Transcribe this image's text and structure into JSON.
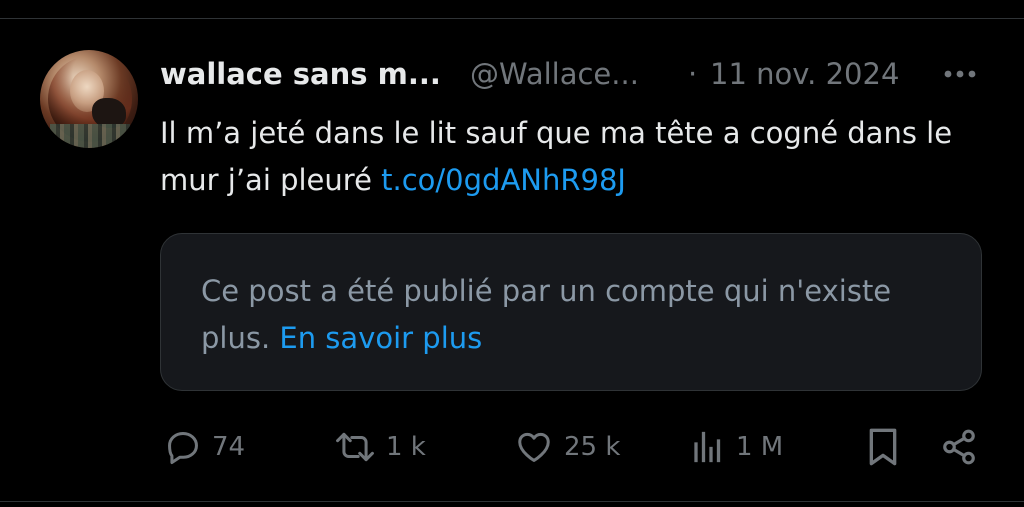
{
  "post": {
    "author": {
      "display_name": "wallace sans m...",
      "handle": "@Wallace...",
      "avatar_icon": "avatar-photo"
    },
    "separator": "·",
    "date": "11 nov. 2024",
    "more_icon": "more-horizontal-icon",
    "text": "Il m’a jeté dans le lit sauf que ma tête a cogné dans le mur j’ai pleuré ",
    "link": "t.co/0gdANhR98J"
  },
  "notice": {
    "text": "Ce post a été publié par un compte qui n'existe plus. ",
    "link": "En savoir plus"
  },
  "actions": {
    "reply": {
      "icon": "reply-icon",
      "count": "74"
    },
    "repost": {
      "icon": "repost-icon",
      "count": "1 k"
    },
    "like": {
      "icon": "heart-icon",
      "count": "25 k"
    },
    "views": {
      "icon": "views-icon",
      "count": "1 M"
    },
    "bookmark": {
      "icon": "bookmark-icon"
    },
    "share": {
      "icon": "share-icon"
    }
  },
  "colors": {
    "background": "#000000",
    "text_primary": "#e7e9ea",
    "text_secondary": "#71767b",
    "link": "#1d9bf0",
    "notice_bg": "#16181c",
    "divider": "#2f3336"
  }
}
